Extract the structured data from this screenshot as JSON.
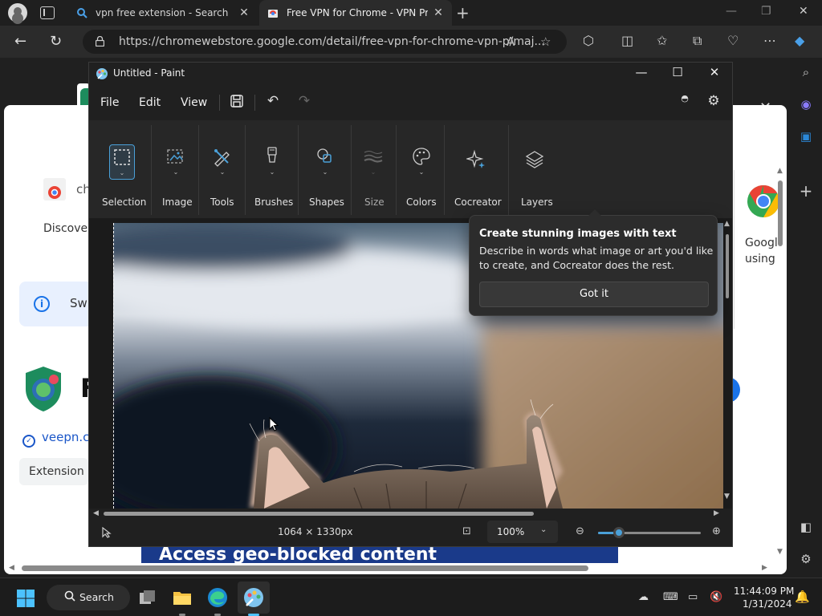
{
  "browser": {
    "tabs": [
      {
        "label": "vpn free extension - Search"
      },
      {
        "label": "Free VPN for Chrome - VPN Proxy"
      }
    ],
    "url": "https://chromewebstore.google.com/detail/free-vpn-for-chrome-vpn-p/maj..."
  },
  "webpage": {
    "chrome_prefix": "ch",
    "discover": "Discover",
    "info_text": "Sw",
    "big_letter": "F",
    "veepn_link": "veepn.c",
    "extension_chip": "Extension",
    "right_line1": "Googl",
    "right_line2": "using",
    "banner": "Access geo-blocked content"
  },
  "paint": {
    "title": "Untitled - Paint",
    "menu": {
      "file": "File",
      "edit": "Edit",
      "view": "View"
    },
    "ribbon": {
      "selection": "Selection",
      "image": "Image",
      "tools": "Tools",
      "brushes": "Brushes",
      "shapes": "Shapes",
      "size": "Size",
      "colors": "Colors",
      "cocreator": "Cocreator",
      "layers": "Layers"
    },
    "tip": {
      "title": "Create stunning images with text",
      "body": "Describe in words what image or art you'd like to create, and Cocreator does the rest.",
      "button": "Got it"
    },
    "status": {
      "dimensions": "1064 × 1330px",
      "zoom": "100%",
      "zoom_fraction": 0.2
    }
  },
  "taskbar": {
    "search": "Search",
    "time": "11:44:09 PM",
    "date": "1/31/2024"
  },
  "colors": {
    "accent": "#4aa0d8",
    "paint_bg": "#202020",
    "ribbon_bg": "#272727"
  }
}
